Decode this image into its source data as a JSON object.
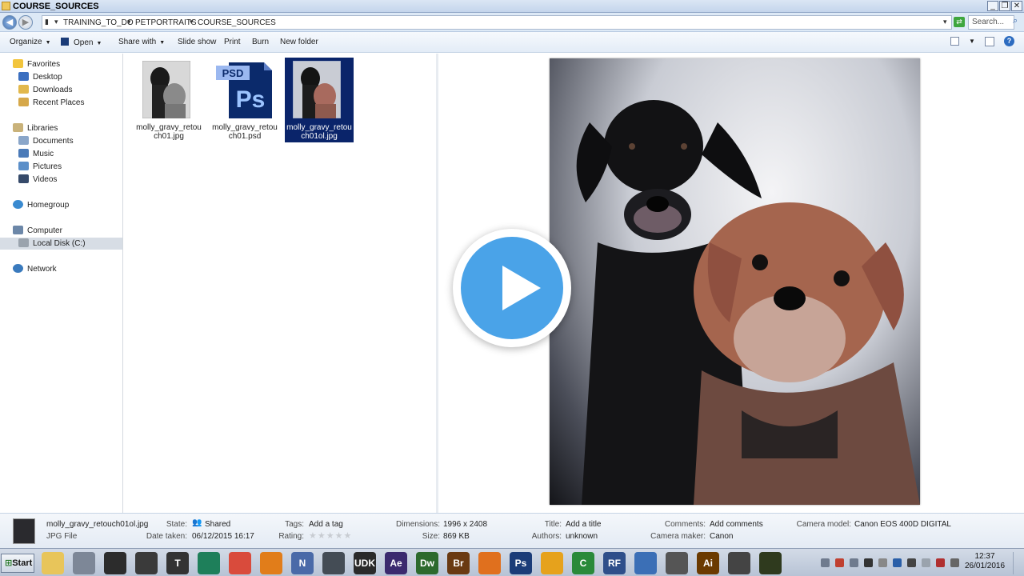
{
  "window": {
    "title": "COURSE_SOURCES"
  },
  "address": {
    "crumbs": [
      "TRAINING_TO_DO",
      "PETPORTRAITS",
      "COURSE_SOURCES"
    ],
    "search_placeholder": "Search..."
  },
  "toolbar": {
    "organize": "Organize",
    "open": "Open",
    "share_with": "Share with",
    "slide_show": "Slide show",
    "print": "Print",
    "burn": "Burn",
    "new_folder": "New folder"
  },
  "sidebar": {
    "favorites": "Favorites",
    "desktop": "Desktop",
    "downloads": "Downloads",
    "recent_places": "Recent Places",
    "libraries": "Libraries",
    "documents": "Documents",
    "music": "Music",
    "pictures": "Pictures",
    "videos": "Videos",
    "homegroup": "Homegroup",
    "computer": "Computer",
    "local_disk": "Local Disk (C:)",
    "network": "Network"
  },
  "files": [
    {
      "name": "molly_gravy_retouch01.jpg",
      "type": "jpg-bw"
    },
    {
      "name": "molly_gravy_retouch01.psd",
      "type": "psd",
      "badge": "PSD",
      "icon_text": "Ps"
    },
    {
      "name": "molly_gravy_retouch01ol.jpg",
      "type": "jpg-color",
      "selected": true
    }
  ],
  "details": {
    "filename": "molly_gravy_retouch01ol.jpg",
    "filetype": "JPG File",
    "state_label": "State:",
    "state_value": "Shared",
    "date_label": "Date taken:",
    "date_value": "06/12/2015 16:17",
    "tags_label": "Tags:",
    "tags_value": "Add a tag",
    "rating_label": "Rating:",
    "rating_value": 0,
    "dimensions_label": "Dimensions:",
    "dimensions_value": "1996 x 2408",
    "size_label": "Size:",
    "size_value": "869 KB",
    "title_label": "Title:",
    "title_value": "Add a title",
    "authors_label": "Authors:",
    "authors_value": "unknown",
    "comments_label": "Comments:",
    "comments_value": "Add comments",
    "camera_maker_label": "Camera maker:",
    "camera_maker_value": "Canon",
    "camera_model_label": "Camera model:",
    "camera_model_value": "Canon EOS 400D DIGITAL"
  },
  "taskbar": {
    "start": "Start",
    "apps": [
      {
        "name": "explorer",
        "text": "",
        "color": "#e8c55a"
      },
      {
        "name": "tools",
        "text": "",
        "color": "#7d8797"
      },
      {
        "name": "recorder",
        "text": "",
        "color": "#2c2c2c"
      },
      {
        "name": "inkscape",
        "text": "",
        "color": "#3a3a3a"
      },
      {
        "name": "typewriter",
        "text": "T",
        "color": "#333333"
      },
      {
        "name": "sketchup",
        "text": "",
        "color": "#1e7f5a"
      },
      {
        "name": "chrome",
        "text": "",
        "color": "#d94b3c"
      },
      {
        "name": "frame",
        "text": "",
        "color": "#e17d1a"
      },
      {
        "name": "n-app",
        "text": "N",
        "color": "#4a6aa8"
      },
      {
        "name": "monster",
        "text": "",
        "color": "#444c55"
      },
      {
        "name": "udk",
        "text": "UDK",
        "color": "#2a2a2a"
      },
      {
        "name": "after-effects",
        "text": "Ae",
        "color": "#3b2a6e"
      },
      {
        "name": "dreamweaver",
        "text": "Dw",
        "color": "#2d6a2d"
      },
      {
        "name": "bridge",
        "text": "Br",
        "color": "#6a3a12"
      },
      {
        "name": "firefox",
        "text": "",
        "color": "#e0701e"
      },
      {
        "name": "photoshop",
        "text": "Ps",
        "color": "#1b3c78"
      },
      {
        "name": "headphones",
        "text": "",
        "color": "#e6a21c"
      },
      {
        "name": "camtasia",
        "text": "C",
        "color": "#2a8a3a"
      },
      {
        "name": "rf",
        "text": "RF",
        "color": "#2f4f8a"
      },
      {
        "name": "aperture",
        "text": "",
        "color": "#3b6fb6"
      },
      {
        "name": "figure",
        "text": "",
        "color": "#555555"
      },
      {
        "name": "illustrator",
        "text": "Ai",
        "color": "#6b3a00"
      },
      {
        "name": "unity",
        "text": "",
        "color": "#444444"
      },
      {
        "name": "bridge-green",
        "text": "",
        "color": "#2f3a1e"
      }
    ]
  },
  "clock": {
    "time": "12:37",
    "date": "26/01/2016"
  }
}
